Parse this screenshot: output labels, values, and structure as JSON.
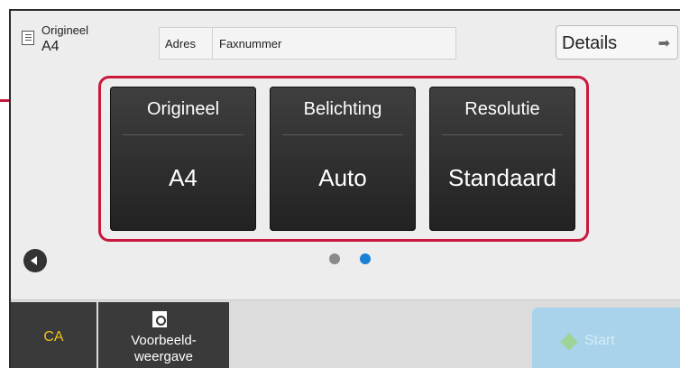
{
  "header": {
    "original_label": "Origineel",
    "original_value": "A4",
    "address_label": "Adres",
    "fax_number": "Faxnummer",
    "details_label": "Details"
  },
  "tiles": [
    {
      "title": "Origineel",
      "value": "A4"
    },
    {
      "title": "Belichting",
      "value": "Auto"
    },
    {
      "title": "Resolutie",
      "value": "Standaard"
    }
  ],
  "pager": {
    "page_count": 2,
    "current_page": 2
  },
  "footer": {
    "ca_label": "CA",
    "preview_label": "Voorbeeld-\nweergave",
    "start_label": "Start"
  },
  "colors": {
    "highlight": "#c8183c",
    "dot_active": "#1a7fd6",
    "dot_inactive": "#8a8a8a",
    "ca_text": "#f2c218"
  }
}
